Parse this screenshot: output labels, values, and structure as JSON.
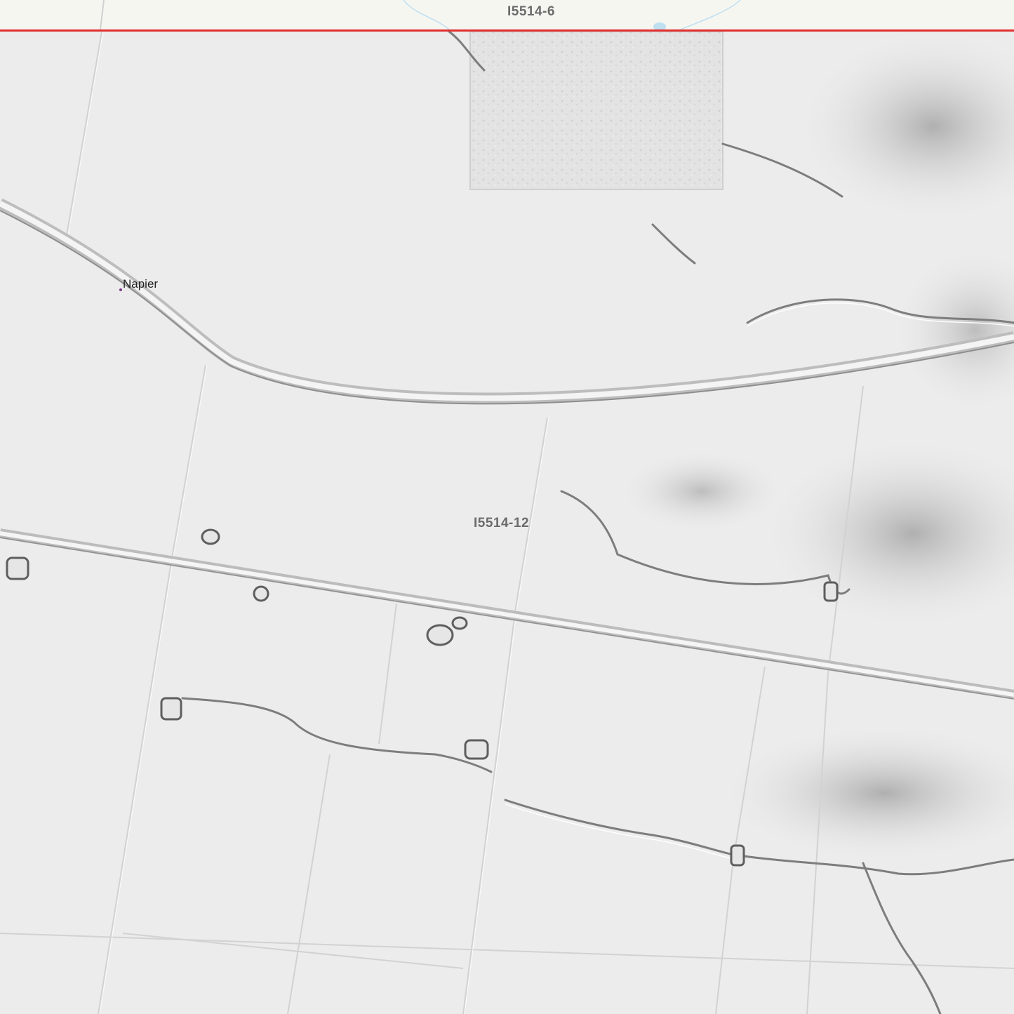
{
  "map": {
    "sheets": {
      "north": "I5514-6",
      "center": "I5514-12"
    },
    "places": [
      {
        "name": "Napier"
      }
    ],
    "colors": {
      "boundary": "#e03030",
      "outside_area": "#f6f6f1",
      "water": "#bfe0f0",
      "hillshade": "#ececec",
      "sheet_label": "#6b6b6b"
    }
  }
}
